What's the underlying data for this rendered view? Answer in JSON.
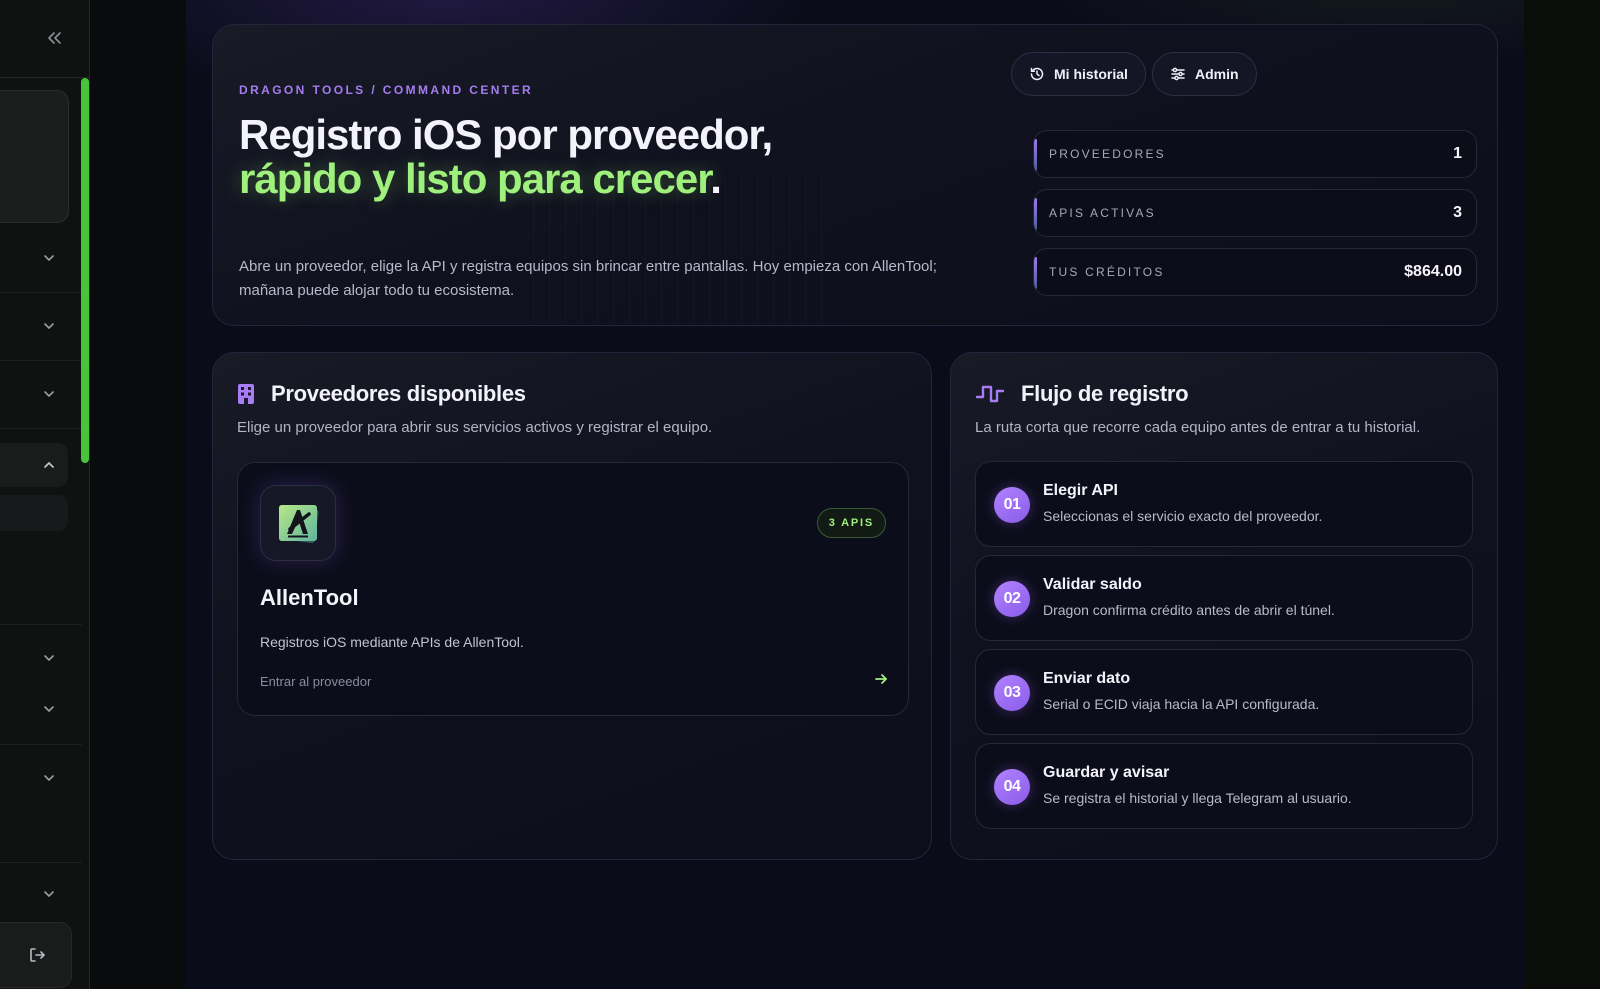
{
  "sidebar": {
    "collapse_icon": "double-chevron-left-icon",
    "logout_icon": "logout-icon"
  },
  "hero": {
    "eyebrow": "DRAGON TOOLS / COMMAND CENTER",
    "title_part1": "Registro iOS por proveedor, ",
    "title_accent1": "rápido y listo para crecer",
    "title_end": ".",
    "description": "Abre un proveedor, elige la API y registra equipos sin brincar entre pantallas. Hoy empieza con AllenTool; mañana puede alojar todo tu ecosistema.",
    "buttons": {
      "history_label": "Mi historial",
      "admin_label": "Admin"
    },
    "stats": [
      {
        "label": "PROVEEDORES",
        "value": "1"
      },
      {
        "label": "APIS ACTIVAS",
        "value": "3"
      },
      {
        "label": "TUS CRÉDITOS",
        "value": "$864.00"
      }
    ]
  },
  "providers": {
    "title": "Proveedores disponibles",
    "subtitle": "Elige un proveedor para abrir sus servicios activos y registrar el equipo.",
    "items": [
      {
        "name": "AllenTool",
        "badge": "3 APIS",
        "description": "Registros iOS mediante APIs de AllenTool.",
        "link": "Entrar al proveedor"
      }
    ]
  },
  "flow": {
    "title": "Flujo de registro",
    "subtitle": "La ruta corta que recorre cada equipo antes de entrar a tu historial.",
    "steps": [
      {
        "num": "01",
        "title": "Elegir API",
        "desc": "Seleccionas el servicio exacto del proveedor."
      },
      {
        "num": "02",
        "title": "Validar saldo",
        "desc": "Dragon confirma crédito antes de abrir el túnel."
      },
      {
        "num": "03",
        "title": "Enviar dato",
        "desc": "Serial o ECID viaja hacia la API configurada."
      },
      {
        "num": "04",
        "title": "Guardar y avisar",
        "desc": "Se registra el historial y llega Telegram al usuario."
      }
    ]
  },
  "colors": {
    "accent_purple": "#a57cf0",
    "accent_green": "#9ff07c",
    "scroll_green": "#46c43a"
  }
}
